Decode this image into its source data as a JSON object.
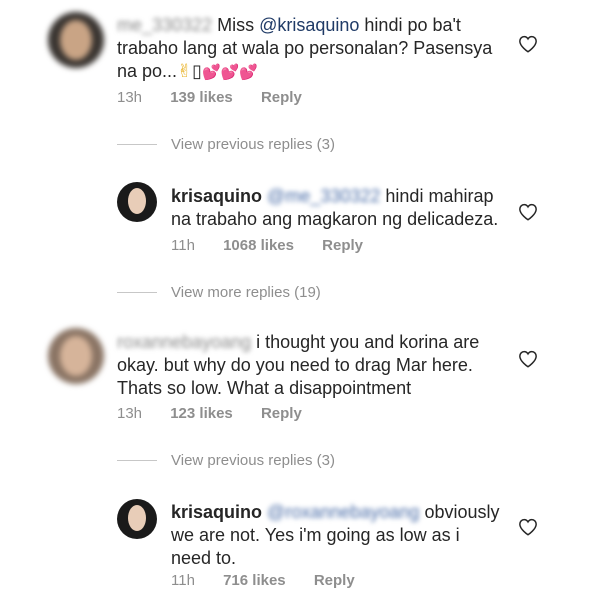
{
  "comments": [
    {
      "username": "me_330322",
      "text_pre": " Miss ",
      "mention": "@krisaquino",
      "text_post": " hindi po ba't trabaho lang at wala po personalan?  Pasensya na po...",
      "emoji_peace": "✌",
      "emoji_box": "▯",
      "emoji_hearts": "💕💕💕",
      "time": "13h",
      "likes": "139 likes",
      "reply": "Reply"
    },
    {
      "username": "krisaquino",
      "mention": "@me_330322",
      "text": " hindi mahirap na trabaho ang magkaron ng delicadeza.",
      "time": "11h",
      "likes": "1068 likes",
      "reply": "Reply"
    },
    {
      "username": "roxannebayoang",
      "text": " i thought you and korina are okay. but why do you need to drag Mar here. Thats so low. What a disappointment",
      "time": "13h",
      "likes": "123 likes",
      "reply": "Reply"
    },
    {
      "username": "krisaquino",
      "mention": "@roxannebayoang",
      "text": " obviously we are not. Yes i'm going as low as i need to.",
      "time": "11h",
      "likes": "716 likes",
      "reply": "Reply"
    }
  ],
  "view_replies": [
    "View previous replies (3)",
    "View more replies (19)",
    "View previous replies (3)"
  ],
  "icons": {
    "like": "heart-outline-icon"
  },
  "colors": {
    "text": "#262626",
    "meta": "#8e8e8e",
    "mention": "#1f3a66"
  }
}
